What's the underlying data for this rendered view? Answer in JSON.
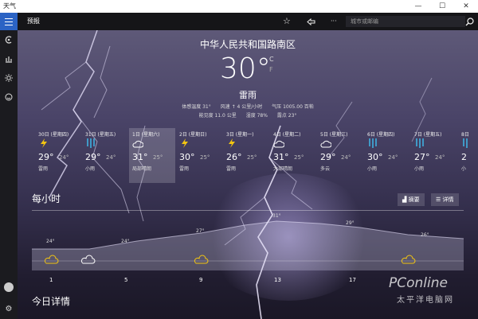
{
  "app": {
    "title": "天气"
  },
  "window_controls": {
    "minimize": "—",
    "maximize": "☐",
    "close": "✕"
  },
  "header": {
    "title": "预报",
    "more": "···",
    "search_placeholder": "城市或邮编"
  },
  "nav": {
    "icons": [
      "menu-icon",
      "news-icon",
      "chart-icon",
      "sun-icon",
      "smile-icon"
    ],
    "settings": "⚙"
  },
  "current": {
    "location": "中华人民共和国路南区",
    "temperature": "30",
    "degree": "°",
    "unit_c": "C",
    "unit_f": "F",
    "condition": "雷雨",
    "details_row1": [
      "体感温度 31°",
      "风速 ↑ 4 公里/小时",
      "气压 1005.00 百帕"
    ],
    "details_row2": [
      "能见度 11.0 公里",
      "湿度 78%",
      "露点 23°"
    ]
  },
  "daily": [
    {
      "name": "30日 (星期四)",
      "icon": "thunder-icon",
      "hi": "29°",
      "lo": "24°",
      "cond": "雷雨"
    },
    {
      "name": "31日 (星期五)",
      "icon": "rain-icon",
      "hi": "29°",
      "lo": "24°",
      "cond": "小雨"
    },
    {
      "name": "1日 (星期六)",
      "icon": "partly-cloudy-icon",
      "hi": "31°",
      "lo": "25°",
      "cond": "局部晴朗"
    },
    {
      "name": "2日 (星期日)",
      "icon": "thunder-icon",
      "hi": "30°",
      "lo": "25°",
      "cond": "雷雨"
    },
    {
      "name": "3日 (星期一)",
      "icon": "thunder-icon",
      "hi": "26°",
      "lo": "25°",
      "cond": "雷雨"
    },
    {
      "name": "4日 (星期二)",
      "icon": "partly-cloudy-icon",
      "hi": "31°",
      "lo": "25°",
      "cond": "大部晴朗"
    },
    {
      "name": "5日 (星期三)",
      "icon": "partly-cloudy-icon",
      "hi": "29°",
      "lo": "24°",
      "cond": "多云"
    },
    {
      "name": "6日 (星期四)",
      "icon": "rain-icon",
      "hi": "30°",
      "lo": "24°",
      "cond": "小雨"
    },
    {
      "name": "7日 (星期五)",
      "icon": "rain-icon",
      "hi": "27°",
      "lo": "24°",
      "cond": "小雨"
    },
    {
      "name": "8日",
      "icon": "rain-icon",
      "hi": "2",
      "lo": "",
      "cond": "小"
    }
  ],
  "hourly": {
    "title": "每小时",
    "summary_btn": "摘要",
    "details_btn": "详情",
    "temps": [
      "24°",
      "24°",
      "27°",
      "31°",
      "29°",
      "26°"
    ],
    "hours": [
      "1",
      "5",
      "9",
      "13",
      "17"
    ]
  },
  "today": {
    "title": "今日详情"
  },
  "watermark": {
    "brand": "PConline",
    "cn": "太平洋电脑网"
  },
  "colors": {
    "accent": "#2b63c4",
    "icon_yellow": "#f2c511",
    "icon_rain": "#3fb0e0"
  }
}
